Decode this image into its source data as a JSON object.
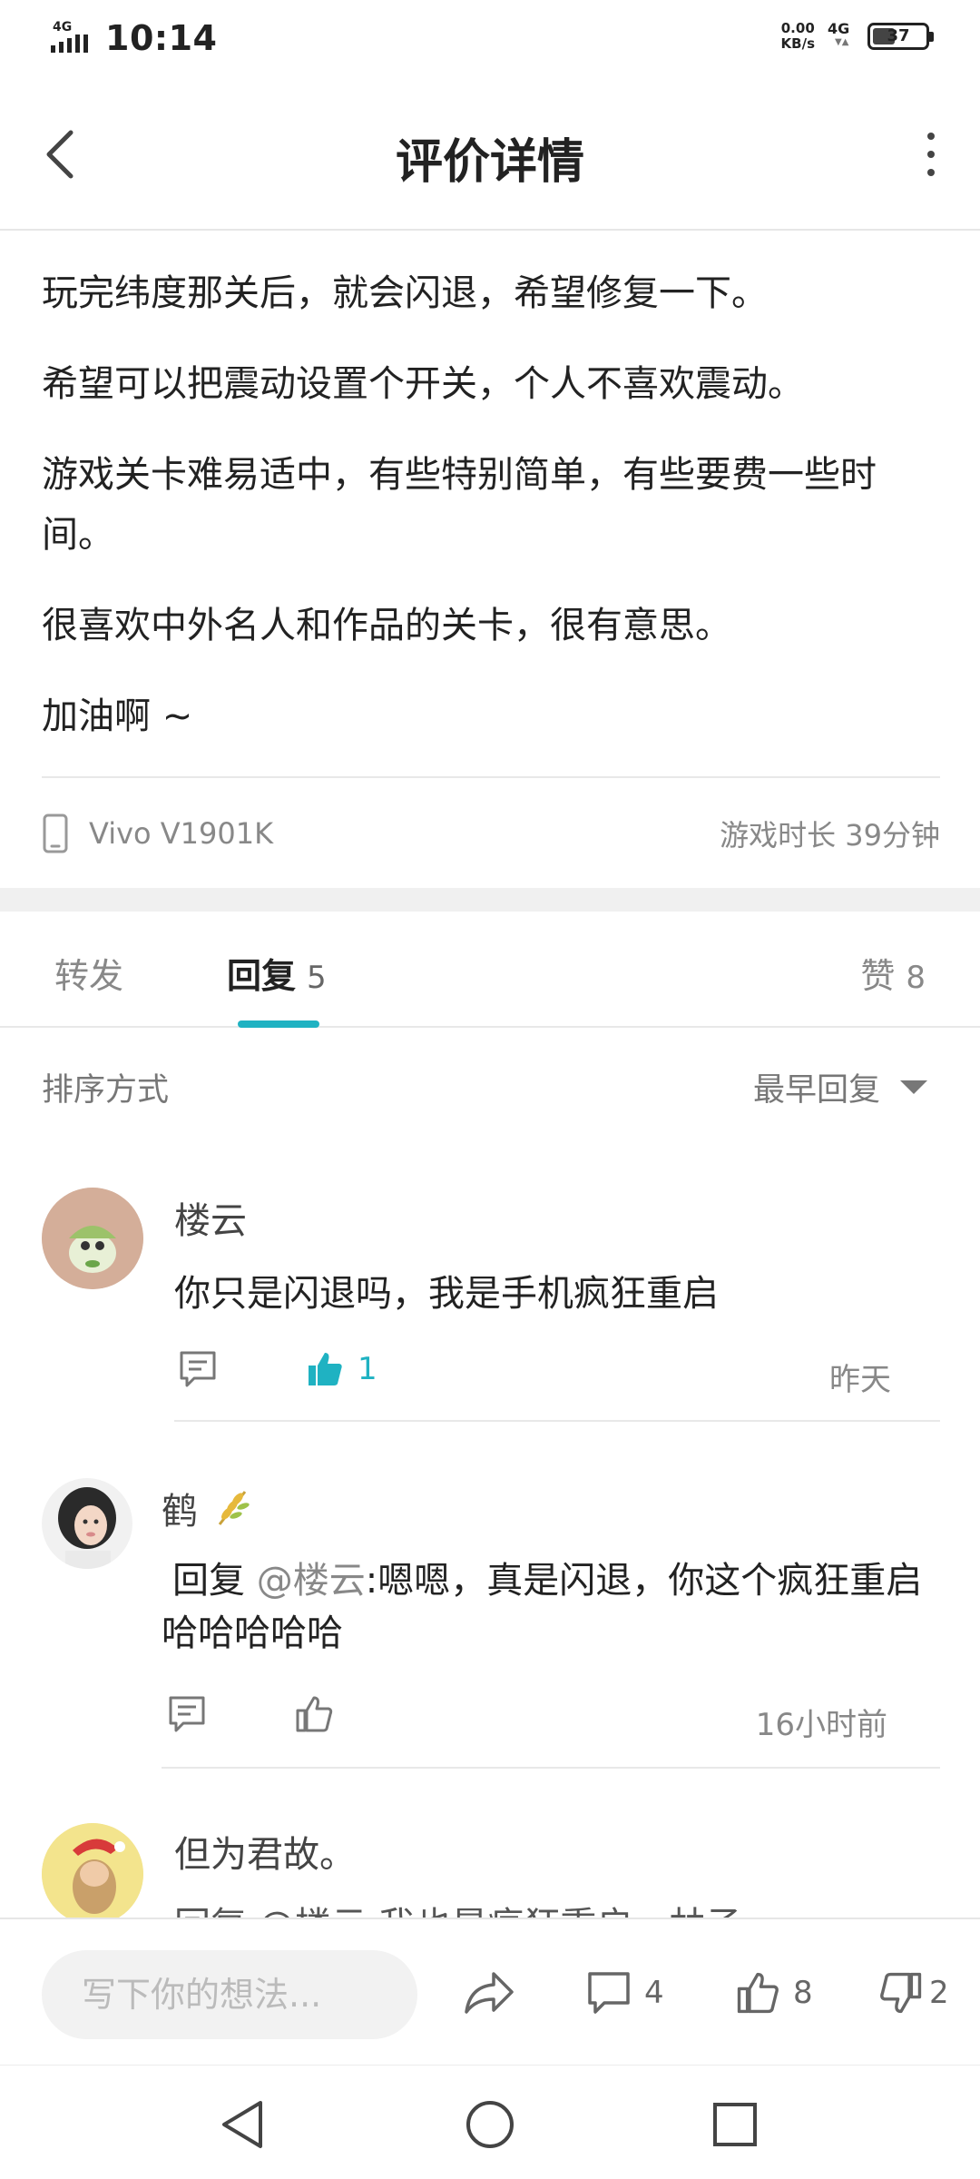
{
  "status_bar": {
    "network_label": "4G",
    "time": "10:14",
    "speed_value": "0.00",
    "speed_unit": "KB/s",
    "data_network": "4G",
    "battery_level": "37"
  },
  "header": {
    "title": "评价详情",
    "back_icon": "chevron-left-icon",
    "more_icon": "more-vertical-icon"
  },
  "review": {
    "paragraphs": [
      "玩完纬度那关后，就会闪退，希望修复一下。",
      "希望可以把震动设置个开关，个人不喜欢震动。",
      "游戏关卡难易适中，有些特别简单，有些要费一些时间。",
      "很喜欢中外名人和作品的关卡，很有意思。",
      "加油啊 ~"
    ],
    "device": "Vivo V1901K",
    "play_time": "游戏时长 39分钟"
  },
  "tabs": {
    "forward_label": "转发",
    "reply_label": "回复",
    "reply_count": "5",
    "like_label": "赞",
    "like_count": "8",
    "active_color": "#1fb2c2"
  },
  "sort": {
    "label": "排序方式",
    "selected": "最早回复"
  },
  "comments": [
    {
      "name": "楼云",
      "text": "你只是闪退吗，我是手机疯狂重启",
      "likes": "1",
      "liked": true,
      "time": "昨天"
    },
    {
      "name": "鹤",
      "reply_prefix": "回复 ",
      "mention": "@楼云",
      "text": ":嗯嗯，真是闪退，你这个疯狂重启哈哈哈哈哈",
      "time": "16小时前",
      "liked": false
    },
    {
      "name": "但为君故。",
      "partial_text": "回复 @楼云 我也是疯狂重启，林子"
    }
  ],
  "bottom_bar": {
    "input_placeholder": "写下你的想法...",
    "comment_count": "4",
    "like_count": "8",
    "dislike_count": "2"
  },
  "colors": {
    "accent": "#1fb2c2",
    "text_primary": "#222222",
    "text_secondary": "#888888",
    "divider": "#e8e8e8"
  }
}
